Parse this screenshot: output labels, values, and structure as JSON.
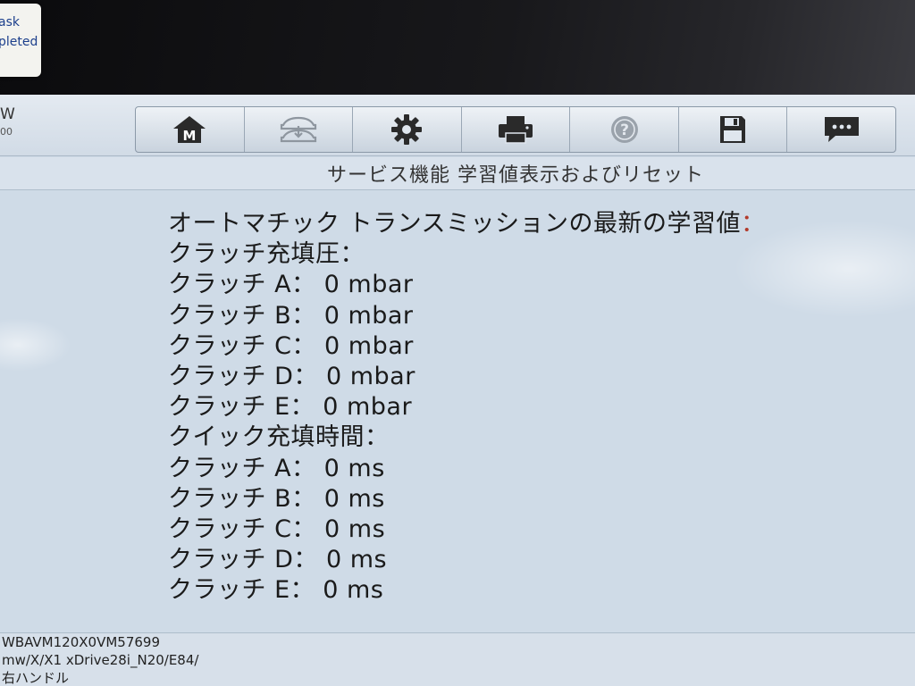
{
  "sticker": {
    "line1": "ask",
    "line2": "pleted"
  },
  "top_left": {
    "letter": "W",
    "sub": "00"
  },
  "toolbar": {
    "buttons": [
      {
        "name": "home",
        "label": "M"
      },
      {
        "name": "vehicle-swap"
      },
      {
        "name": "settings"
      },
      {
        "name": "print"
      },
      {
        "name": "help",
        "label": "?"
      },
      {
        "name": "save"
      },
      {
        "name": "messages"
      }
    ]
  },
  "title": "サービス機能 学習値表示およびリセット",
  "content": {
    "heading": "オートマチック トランスミッションの最新の学習値",
    "heading_colon": "：",
    "pressure_section": "クラッチ充填圧：",
    "pressure_rows": [
      "クラッチ A： 0 mbar",
      "クラッチ B： 0 mbar",
      "クラッチ C： 0 mbar",
      "クラッチ D： 0 mbar",
      "クラッチ E： 0 mbar"
    ],
    "time_section": "クイック充填時間：",
    "time_rows": [
      "クラッチ A： 0 ms",
      "クラッチ B： 0 ms",
      "クラッチ C： 0 ms",
      "クラッチ D： 0 ms",
      "クラッチ E： 0 ms"
    ]
  },
  "footer": {
    "vin": "WBAVM120X0VM57699",
    "vehicle": "mw/X/X1 xDrive28i_N20/E84/",
    "extra": "右ハンドル"
  },
  "colors": {
    "screen_bg": "#cfdbe7",
    "accent": "#b23a2a",
    "text": "#1a1a1a"
  }
}
